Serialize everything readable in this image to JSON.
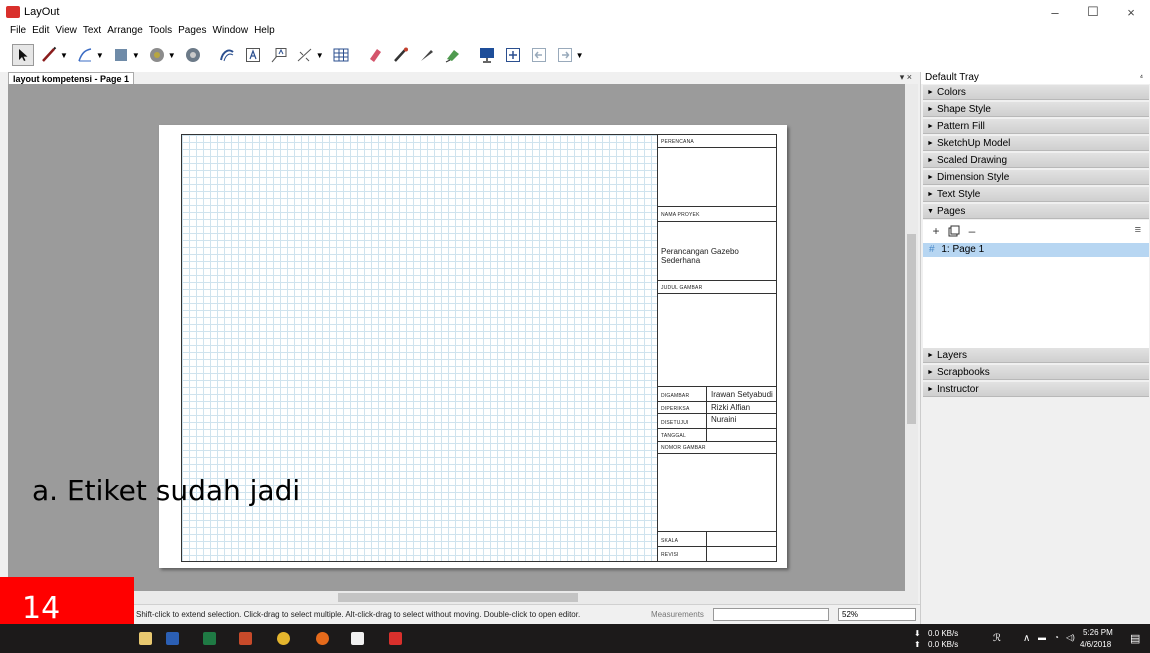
{
  "window": {
    "title": "LayOut",
    "minimize": "–",
    "maximize": "☐",
    "close": "×"
  },
  "menu": [
    "File",
    "Edit",
    "View",
    "Text",
    "Arrange",
    "Tools",
    "Pages",
    "Window",
    "Help"
  ],
  "document": {
    "tab_label": "layout kompetensi - Page 1",
    "tab_close": "▾ ×"
  },
  "title_block": {
    "perencana_label": "PERENCANA",
    "nama_proyek_label": "NAMA PROYEK",
    "nama_proyek_value": "Perancangan Gazebo Sederhana",
    "judul_gambar_label": "JUDUL GAMBAR",
    "digambar_label": "DIGAMBAR",
    "digambar_value": "Irawan Setyabudi",
    "diperiksa_label": "DIPERIKSA",
    "diperiksa_value": "Rizki Alfian",
    "disetujui_label": "DISETUJUI",
    "disetujui_value": "Nuraini",
    "tanggal_label": "TANGGAL",
    "nomor_gambar_label": "NOMOR GAMBAR",
    "skala_label": "SKALA",
    "revisi_label": "REVISI"
  },
  "slide": {
    "caption": "a.   Etiket sudah jadi",
    "number": "14"
  },
  "status": {
    "hint": "Shift-click to extend selection. Click-drag to select multiple. Alt-click-drag to select without moving. Double-click to open editor.",
    "measurements_label": "Measurements",
    "measurements_value": "",
    "zoom": "52%"
  },
  "tray": {
    "title": "Default Tray",
    "pin": "⁴",
    "panels_top": [
      "Colors",
      "Shape Style",
      "Pattern Fill",
      "SketchUp Model",
      "Scaled Drawing",
      "Dimension Style",
      "Text Style"
    ],
    "pages_panel": "Pages",
    "pages": [
      {
        "num": "1:",
        "name": "Page 1"
      }
    ],
    "panels_bottom": [
      "Layers",
      "Scrapbooks",
      "Instructor"
    ]
  },
  "taskbar": {
    "net_down": "0.0 KB/s",
    "net_up": "0.0 KB/s",
    "time": "5:26 PM",
    "date": "4/6/2018"
  }
}
